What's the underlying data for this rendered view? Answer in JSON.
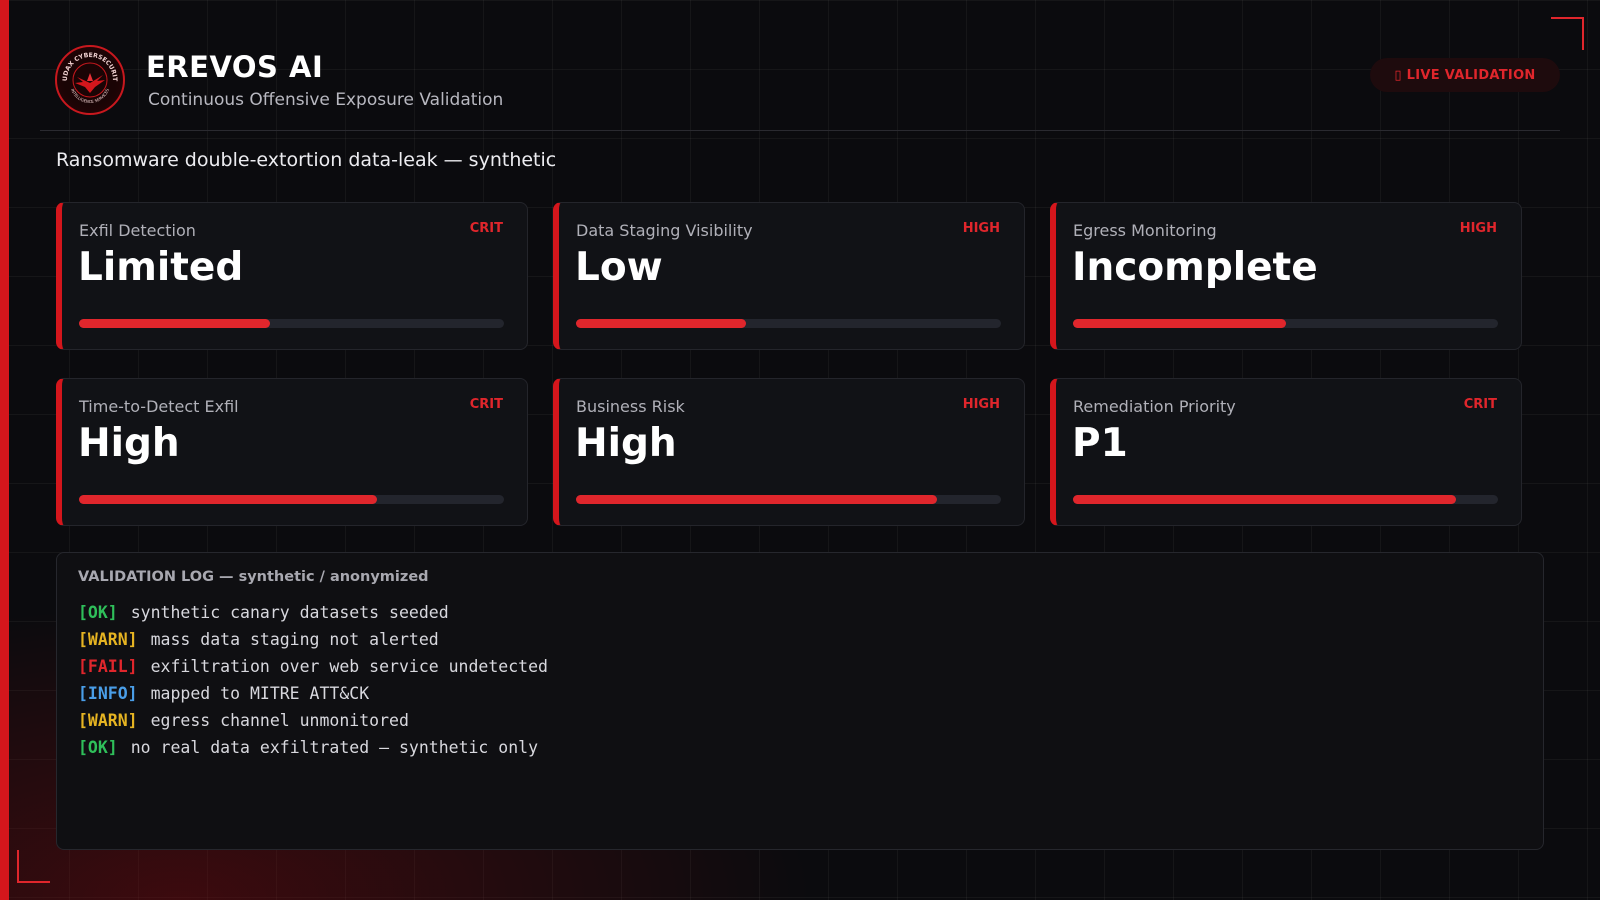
{
  "header": {
    "title": "EREVOS AI",
    "subtitle": "Continuous Offensive Exposure Validation",
    "logo_icon": "audax-cybersecurity-seal-icon",
    "logo_text_top": "AUDAX CYBERSECURITY",
    "logo_text_bottom": "INTELLIGENCE SERVICES",
    "live_badge": "▯ LIVE VALIDATION"
  },
  "scenario": "Ransomware double-extortion data-leak — synthetic",
  "cards": [
    {
      "label": "Exfil Detection",
      "severity": "CRIT",
      "value": "Limited",
      "level": 0.45
    },
    {
      "label": "Data Staging Visibility",
      "severity": "HIGH",
      "value": "Low",
      "level": 0.4
    },
    {
      "label": "Egress Monitoring",
      "severity": "HIGH",
      "value": "Incomplete",
      "level": 0.5
    },
    {
      "label": "Time-to-Detect Exfil",
      "severity": "CRIT",
      "value": "High",
      "level": 0.7
    },
    {
      "label": "Business Risk",
      "severity": "HIGH",
      "value": "High",
      "level": 0.85
    },
    {
      "label": "Remediation Priority",
      "severity": "CRIT",
      "value": "P1",
      "level": 0.9
    }
  ],
  "log": {
    "title": "VALIDATION LOG — synthetic / anonymized",
    "entries": [
      {
        "tag": "[OK]",
        "text": "synthetic canary datasets seeded"
      },
      {
        "tag": "[WARN]",
        "text": "mass data staging not alerted"
      },
      {
        "tag": "[FAIL]",
        "text": "exfiltration over web service undetected"
      },
      {
        "tag": "[INFO]",
        "text": "mapped to MITRE ATT&CK"
      },
      {
        "tag": "[WARN]",
        "text": "egress channel unmonitored"
      },
      {
        "tag": "[OK]",
        "text": "no real data exfiltrated — synthetic only"
      }
    ]
  },
  "colors": {
    "accent": "#e0262c",
    "ok": "#2fbf5a",
    "warn": "#e6b422",
    "fail": "#e0262c",
    "info": "#4a9ee8"
  }
}
